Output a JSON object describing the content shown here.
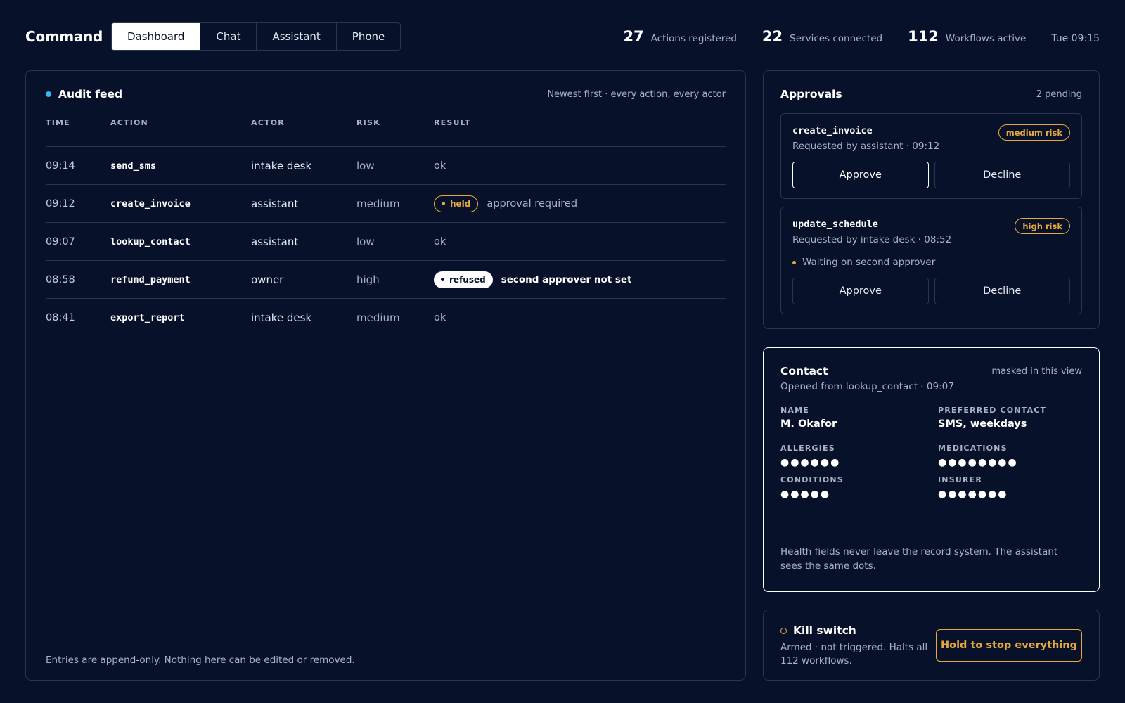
{
  "header": {
    "brand": "Command",
    "tabs": [
      {
        "label": "Dashboard",
        "active": true
      },
      {
        "label": "Chat",
        "active": false
      },
      {
        "label": "Assistant",
        "active": false
      },
      {
        "label": "Phone",
        "active": false
      }
    ],
    "stats": [
      {
        "value": "27",
        "label": "Actions registered"
      },
      {
        "value": "22",
        "label": "Services connected"
      },
      {
        "value": "112",
        "label": "Workflows active"
      }
    ],
    "clock": "Tue 09:15"
  },
  "audit": {
    "title": "Audit feed",
    "note": "Newest first · every action, every actor",
    "columns": [
      "TIME",
      "ACTION",
      "ACTOR",
      "RISK",
      "RESULT"
    ],
    "rows": [
      {
        "time": "09:14",
        "action": "send_sms",
        "actor": "intake desk",
        "risk": "low",
        "result_badge": "",
        "result": "ok"
      },
      {
        "time": "09:12",
        "action": "create_invoice",
        "actor": "assistant",
        "risk": "medium",
        "result_badge": "held",
        "result": "approval required"
      },
      {
        "time": "09:07",
        "action": "lookup_contact",
        "actor": "assistant",
        "risk": "low",
        "result_badge": "",
        "result": "ok"
      },
      {
        "time": "08:58",
        "action": "refund_payment",
        "actor": "owner",
        "risk": "high",
        "result_badge": "refused",
        "result": "second approver not set"
      },
      {
        "time": "08:41",
        "action": "export_report",
        "actor": "intake desk",
        "risk": "medium",
        "result_badge": "",
        "result": "ok"
      }
    ],
    "footer": "Entries are append-only. Nothing here can be edited or removed."
  },
  "approvals": {
    "title": "Approvals",
    "count": "2 pending",
    "items": [
      {
        "name": "create_invoice",
        "requested": "Requested by assistant · 09:12",
        "risk": "medium risk",
        "status": "",
        "approve": "Approve",
        "decline": "Decline"
      },
      {
        "name": "update_schedule",
        "requested": "Requested by intake desk · 08:52",
        "risk": "high risk",
        "status": "Waiting on second approver",
        "approve": "Approve",
        "decline": "Decline"
      }
    ]
  },
  "contact": {
    "title": "Contact",
    "masked_note": "masked in this view",
    "subtitle": "Opened from lookup_contact · 09:07",
    "fields": {
      "name": {
        "label": "NAME",
        "value": "M. Okafor"
      },
      "preferred": {
        "label": "PREFERRED CONTACT",
        "value": "SMS, weekdays"
      },
      "allergies": {
        "label": "ALLERGIES",
        "value": "●●●●●●"
      },
      "medications": {
        "label": "MEDICATIONS",
        "value": "●●●●●●●●"
      },
      "conditions": {
        "label": "CONDITIONS",
        "value": "●●●●●"
      },
      "insurer": {
        "label": "INSURER",
        "value": "●●●●●●●"
      }
    },
    "footer": "Health fields never leave the record system. The assistant sees the same dots."
  },
  "kill_switch": {
    "title": "Kill switch",
    "status": "Armed · not triggered. Halts all 112 workflows.",
    "button": "Hold to stop everything"
  },
  "colors": {
    "background": "#07112a",
    "border": "#2a3550",
    "accent_blue": "#38b6f5",
    "warning": "#e8a93c",
    "text_muted": "#a9b3c6"
  }
}
